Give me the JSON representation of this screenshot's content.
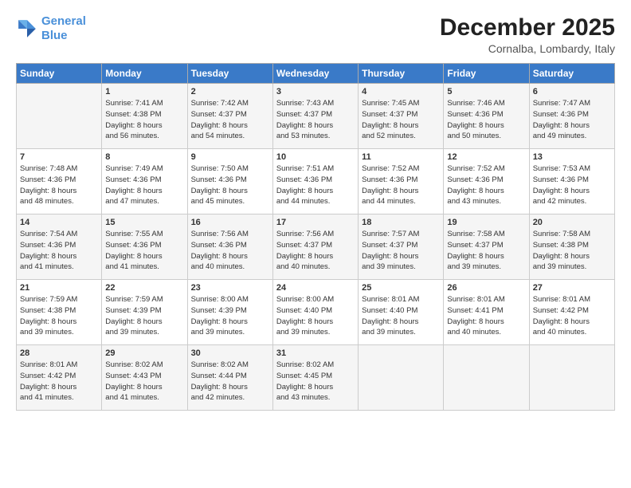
{
  "header": {
    "logo_line1": "General",
    "logo_line2": "Blue",
    "month": "December 2025",
    "location": "Cornalba, Lombardy, Italy"
  },
  "days_of_week": [
    "Sunday",
    "Monday",
    "Tuesday",
    "Wednesday",
    "Thursday",
    "Friday",
    "Saturday"
  ],
  "weeks": [
    [
      {
        "day": "",
        "text": ""
      },
      {
        "day": "1",
        "text": "Sunrise: 7:41 AM\nSunset: 4:38 PM\nDaylight: 8 hours\nand 56 minutes."
      },
      {
        "day": "2",
        "text": "Sunrise: 7:42 AM\nSunset: 4:37 PM\nDaylight: 8 hours\nand 54 minutes."
      },
      {
        "day": "3",
        "text": "Sunrise: 7:43 AM\nSunset: 4:37 PM\nDaylight: 8 hours\nand 53 minutes."
      },
      {
        "day": "4",
        "text": "Sunrise: 7:45 AM\nSunset: 4:37 PM\nDaylight: 8 hours\nand 52 minutes."
      },
      {
        "day": "5",
        "text": "Sunrise: 7:46 AM\nSunset: 4:36 PM\nDaylight: 8 hours\nand 50 minutes."
      },
      {
        "day": "6",
        "text": "Sunrise: 7:47 AM\nSunset: 4:36 PM\nDaylight: 8 hours\nand 49 minutes."
      }
    ],
    [
      {
        "day": "7",
        "text": "Sunrise: 7:48 AM\nSunset: 4:36 PM\nDaylight: 8 hours\nand 48 minutes."
      },
      {
        "day": "8",
        "text": "Sunrise: 7:49 AM\nSunset: 4:36 PM\nDaylight: 8 hours\nand 47 minutes."
      },
      {
        "day": "9",
        "text": "Sunrise: 7:50 AM\nSunset: 4:36 PM\nDaylight: 8 hours\nand 45 minutes."
      },
      {
        "day": "10",
        "text": "Sunrise: 7:51 AM\nSunset: 4:36 PM\nDaylight: 8 hours\nand 44 minutes."
      },
      {
        "day": "11",
        "text": "Sunrise: 7:52 AM\nSunset: 4:36 PM\nDaylight: 8 hours\nand 44 minutes."
      },
      {
        "day": "12",
        "text": "Sunrise: 7:52 AM\nSunset: 4:36 PM\nDaylight: 8 hours\nand 43 minutes."
      },
      {
        "day": "13",
        "text": "Sunrise: 7:53 AM\nSunset: 4:36 PM\nDaylight: 8 hours\nand 42 minutes."
      }
    ],
    [
      {
        "day": "14",
        "text": "Sunrise: 7:54 AM\nSunset: 4:36 PM\nDaylight: 8 hours\nand 41 minutes."
      },
      {
        "day": "15",
        "text": "Sunrise: 7:55 AM\nSunset: 4:36 PM\nDaylight: 8 hours\nand 41 minutes."
      },
      {
        "day": "16",
        "text": "Sunrise: 7:56 AM\nSunset: 4:36 PM\nDaylight: 8 hours\nand 40 minutes."
      },
      {
        "day": "17",
        "text": "Sunrise: 7:56 AM\nSunset: 4:37 PM\nDaylight: 8 hours\nand 40 minutes."
      },
      {
        "day": "18",
        "text": "Sunrise: 7:57 AM\nSunset: 4:37 PM\nDaylight: 8 hours\nand 39 minutes."
      },
      {
        "day": "19",
        "text": "Sunrise: 7:58 AM\nSunset: 4:37 PM\nDaylight: 8 hours\nand 39 minutes."
      },
      {
        "day": "20",
        "text": "Sunrise: 7:58 AM\nSunset: 4:38 PM\nDaylight: 8 hours\nand 39 minutes."
      }
    ],
    [
      {
        "day": "21",
        "text": "Sunrise: 7:59 AM\nSunset: 4:38 PM\nDaylight: 8 hours\nand 39 minutes."
      },
      {
        "day": "22",
        "text": "Sunrise: 7:59 AM\nSunset: 4:39 PM\nDaylight: 8 hours\nand 39 minutes."
      },
      {
        "day": "23",
        "text": "Sunrise: 8:00 AM\nSunset: 4:39 PM\nDaylight: 8 hours\nand 39 minutes."
      },
      {
        "day": "24",
        "text": "Sunrise: 8:00 AM\nSunset: 4:40 PM\nDaylight: 8 hours\nand 39 minutes."
      },
      {
        "day": "25",
        "text": "Sunrise: 8:01 AM\nSunset: 4:40 PM\nDaylight: 8 hours\nand 39 minutes."
      },
      {
        "day": "26",
        "text": "Sunrise: 8:01 AM\nSunset: 4:41 PM\nDaylight: 8 hours\nand 40 minutes."
      },
      {
        "day": "27",
        "text": "Sunrise: 8:01 AM\nSunset: 4:42 PM\nDaylight: 8 hours\nand 40 minutes."
      }
    ],
    [
      {
        "day": "28",
        "text": "Sunrise: 8:01 AM\nSunset: 4:42 PM\nDaylight: 8 hours\nand 41 minutes."
      },
      {
        "day": "29",
        "text": "Sunrise: 8:02 AM\nSunset: 4:43 PM\nDaylight: 8 hours\nand 41 minutes."
      },
      {
        "day": "30",
        "text": "Sunrise: 8:02 AM\nSunset: 4:44 PM\nDaylight: 8 hours\nand 42 minutes."
      },
      {
        "day": "31",
        "text": "Sunrise: 8:02 AM\nSunset: 4:45 PM\nDaylight: 8 hours\nand 43 minutes."
      },
      {
        "day": "",
        "text": ""
      },
      {
        "day": "",
        "text": ""
      },
      {
        "day": "",
        "text": ""
      }
    ]
  ]
}
